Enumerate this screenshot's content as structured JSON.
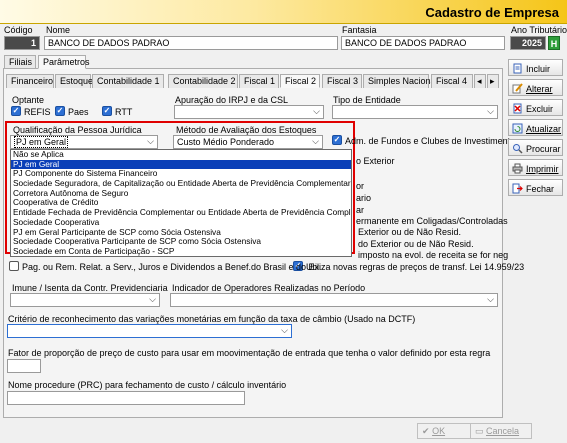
{
  "window": {
    "title": "Cadastro de Empresa"
  },
  "header": {
    "codigo_label": "Código",
    "codigo_value": "1",
    "nome_label": "Nome",
    "nome_value": "BANCO DE DADOS PADRAO",
    "fantasia_label": "Fantasia",
    "fantasia_value": "BANCO DE DADOS PADRAO",
    "ano_label": "Ano Tributário",
    "ano_value": "2025"
  },
  "main_tabs": [
    "Filiais",
    "Parâmetros"
  ],
  "sub_tabs": [
    "Financeiro",
    "Estoque",
    "Contabilidade 1",
    "Contabilidade 2",
    "Fiscal 1",
    "Fiscal 2",
    "Fiscal 3",
    "Simples Nacional",
    "Fiscal 4"
  ],
  "optante": {
    "label": "Optante",
    "refis": "REFIS",
    "paes": "Paes",
    "rtt": "RTT"
  },
  "apuracao_label": "Apuração do IRPJ e da CSL",
  "tipo_entidade_label": "Tipo de Entidade",
  "qualificacao": {
    "label": "Qualificação da Pessoa Jurídica",
    "value": "PJ em Geral",
    "options": [
      "Não se Aplica",
      "PJ em Geral",
      "PJ Componente do Sistema Financeiro",
      "Sociedade Seguradora, de Capitalização ou Entidade Aberta de Previdência Complementar (com fins",
      "Corretora Autônoma de Seguro",
      "Cooperativa de Crédito",
      "Entidade Fechada de Previdência Complementar ou Entidade Aberta de Previdência Complementar",
      "Sociedade Cooperativa",
      "PJ em Geral Participante de SCP como Sócia Ostensiva",
      "Sociedade Cooperativa Participante de SCP como Sócia Ostensiva",
      "Sociedade em Conta de Participação - SCP"
    ]
  },
  "metodo": {
    "label": "Método de Avaliação dos Estoques",
    "value": "Custo Médio Ponderado"
  },
  "right_options": {
    "adm_fundos": "Adm. de Fundos e Clubes de Investimento",
    "exterior": "o Exterior",
    "or": "or",
    "ario": "ario",
    "ar": "ar",
    "permanente": "ermanente em Coligadas/Controladas",
    "exterior_resid": "Exterior ou de Não Resid.",
    "bens_exterior": "do Exterior ou de Não Resid.",
    "evol_receita": "imposto na evol. de receita se for neg",
    "novas_regras": "Utiliza novas regras de preços de transf.  Lei 14.959/23"
  },
  "pag_rem": "Pag. ou Rem.  Relat. a Serv., Juros e Dividendos a Benef.do Brasil e do Ex.",
  "imune_label": "Imune / Isenta da Contr. Previdenciaria",
  "indicador_label": "Indicador de Operadores Realizadas no Período",
  "criterio_label": "Critério de reconhecimento das variações monetárias em função da taxa de câmbio  (Usado na DCTF)",
  "fator_label": "Fator de proporção de preço de custo para usar em moovimentação de entrada que tenha o valor definido por esta regra",
  "procedure_label": "Nome procedure (PRC) para fechamento de custo / cálculo inventário",
  "side_buttons": {
    "incluir": "Incluir",
    "alterar": "Alterar",
    "excluir": "Excluir",
    "atualizar": "Atualizar",
    "procurar": "Procurar",
    "imprimir": "Imprimir",
    "fechar": "Fechar"
  },
  "bottom_buttons": {
    "ok": "OK",
    "cancela": "Cancela"
  },
  "colors": {
    "selection": "#0a3fb8",
    "highlight_border": "#e00000",
    "title_gradient_end": "#f5c518"
  }
}
